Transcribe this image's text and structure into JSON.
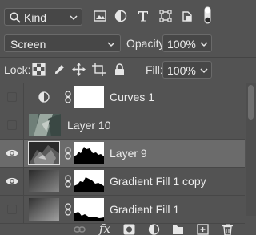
{
  "filter": {
    "kind_label": "Kind",
    "icons": [
      "image-filter-icon",
      "adjustment-filter-icon",
      "type-filter-icon",
      "shape-filter-icon",
      "smart-object-filter-icon",
      "filter-toggle"
    ]
  },
  "blend": {
    "mode": "Screen",
    "opacity_label": "Opacity:",
    "opacity_value": "100%"
  },
  "lock": {
    "label": "Lock:",
    "fill_label": "Fill:",
    "fill_value": "100%"
  },
  "layers": [
    {
      "name": "Curves 1",
      "visible": false,
      "type": "adjustment",
      "selected": false
    },
    {
      "name": "Layer 10",
      "visible": false,
      "type": "pixel",
      "selected": false
    },
    {
      "name": "Layer 9",
      "visible": true,
      "type": "masked-pixel",
      "selected": true
    },
    {
      "name": "Gradient Fill 1 copy",
      "visible": true,
      "type": "gradient",
      "selected": false
    },
    {
      "name": "Gradient Fill 1",
      "visible": false,
      "type": "gradient",
      "selected": false
    }
  ],
  "bottom_toolbar": {
    "fx_label": "fx",
    "icons": [
      "link-layers-icon",
      "fx-icon",
      "add-mask-icon",
      "new-adjustment-icon",
      "new-group-icon",
      "new-layer-icon",
      "delete-layer-icon"
    ]
  },
  "colors": {
    "panel_bg": "#535353",
    "selected_row": "#6b6b6b",
    "text": "#ececec"
  }
}
